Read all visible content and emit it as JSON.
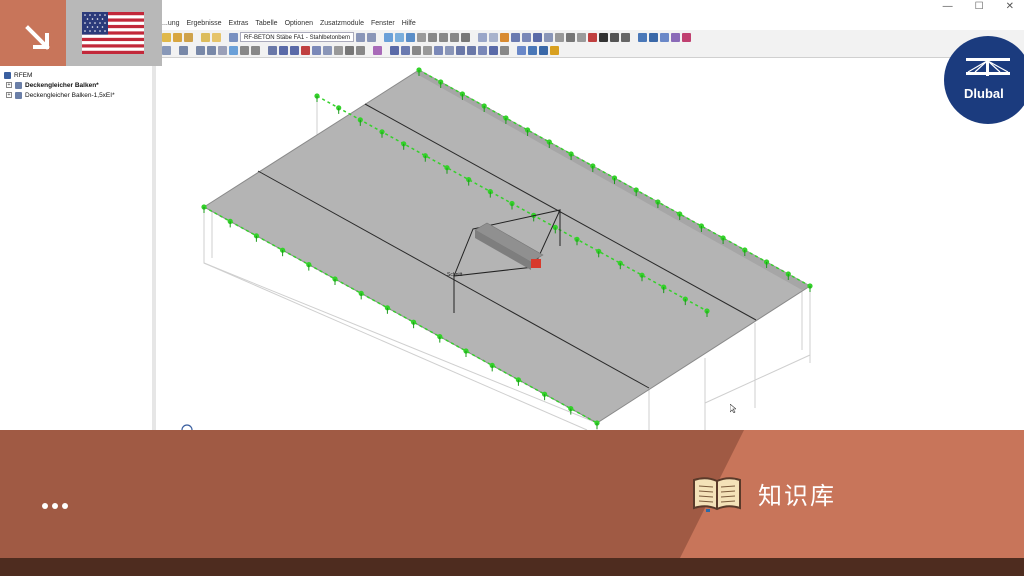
{
  "window": {
    "controls": [
      "—",
      "☐",
      "✕"
    ]
  },
  "menu": {
    "items": [
      "...ung",
      "Ergebnisse",
      "Extras",
      "Tabelle",
      "Optionen",
      "Zusatzmodule",
      "Fenster",
      "Hilfe"
    ]
  },
  "toolbar": {
    "module_combo": "RF-BETON Stäbe FA1 - Stahlbetonbem"
  },
  "navigator": {
    "root_label": "RFEM",
    "items": [
      {
        "label": "Deckengleicher Balken*",
        "bold": true
      },
      {
        "label": "Deckengleicher Balken-1,5xEI*",
        "bold": false
      }
    ]
  },
  "viewport": {
    "annotation": "Schnitt",
    "colors": {
      "plate": "#b4b4b4",
      "support": "#34d12a",
      "frame": "#cfcfcf",
      "beam": "#d83a2c"
    }
  },
  "overlay": {
    "brand": "Dlubal",
    "flag": "US",
    "corner_icon": "arrow-down-right-icon",
    "more_icon": "ellipsis-icon",
    "knowledge_icon": "open-book-icon",
    "knowledge_label": "知识库",
    "accent": "#c8755a",
    "banner_color": "#a05a44",
    "brand_color": "#1b3b7e"
  }
}
